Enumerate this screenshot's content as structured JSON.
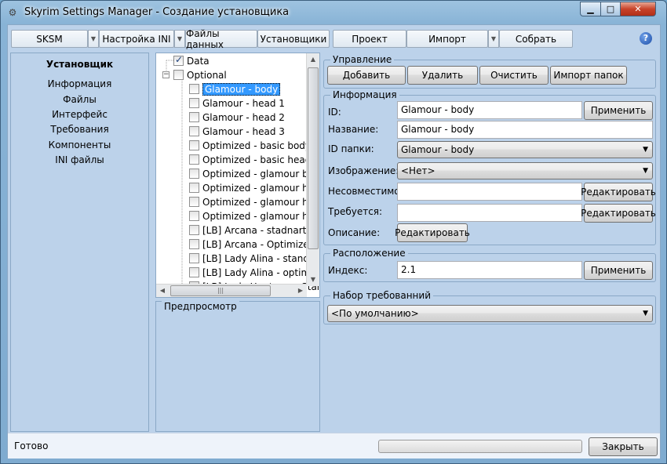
{
  "window": {
    "title": "Skyrim Settings Manager - Создание установщика"
  },
  "menubar": {
    "items": [
      "SKSM",
      "Настройка INI",
      "Файлы данных",
      "Установщики",
      "Проект",
      "Импорт",
      "Собрать"
    ],
    "help_icon": "?"
  },
  "sidebar": {
    "title": "Установщик",
    "items": [
      "Информация",
      "Файлы",
      "Интерфейс",
      "Требования",
      "Компоненты",
      "INI файлы"
    ]
  },
  "tree": {
    "nodes": [
      {
        "label": "Data",
        "checked": true
      },
      {
        "label": "Optional",
        "checked": false
      },
      {
        "label": "Glamour - body",
        "checked": false,
        "selected": true
      },
      {
        "label": "Glamour - head 1",
        "checked": false
      },
      {
        "label": "Glamour - head 2",
        "checked": false
      },
      {
        "label": "Glamour - head 3",
        "checked": false
      },
      {
        "label": "Optimized - basic body",
        "checked": false
      },
      {
        "label": "Optimized - basic head",
        "checked": false
      },
      {
        "label": "Optimized - glamour body",
        "checked": false
      },
      {
        "label": "Optimized - glamour head",
        "checked": false
      },
      {
        "label": "Optimized - glamour head",
        "checked": false
      },
      {
        "label": "Optimized - glamour head",
        "checked": false
      },
      {
        "label": "[LB] Arcana - stadnart",
        "checked": false
      },
      {
        "label": "[LB] Arcana - Optimized",
        "checked": false
      },
      {
        "label": "[LB] Lady Alina - standart",
        "checked": false
      },
      {
        "label": "[LB] Lady Alina - optimized",
        "checked": false
      },
      {
        "label": "[LB] Lady Huntress - Standart",
        "checked": false
      }
    ],
    "hscroll_grip": "|||"
  },
  "preview": {
    "legend": "Предпросмотр"
  },
  "management": {
    "legend": "Управление",
    "add": "Добавить",
    "delete": "Удалить",
    "clear": "Очистить",
    "import_folders": "Импорт папок"
  },
  "info": {
    "legend": "Информация",
    "id_label": "ID:",
    "id_value": "Glamour - body",
    "apply": "Применить",
    "name_label": "Название:",
    "name_value": "Glamour - body",
    "folder_label": "ID папки:",
    "folder_value": "Glamour - body",
    "image_label": "Изображение:",
    "image_value": "<Нет>",
    "incompatible_label": "Несовместимо:",
    "incompatible_value": "",
    "edit": "Редактировать",
    "required_label": "Требуется:",
    "required_value": "",
    "description_label": "Описание:"
  },
  "location": {
    "legend": "Расположение",
    "index_label": "Индекс:",
    "index_value": "2.1",
    "apply": "Применить"
  },
  "requirements_set": {
    "legend": "Набор требованний",
    "value": "<По умолчанию>"
  },
  "status": {
    "text": "Готово",
    "progress": 0,
    "close": "Закрыть"
  }
}
